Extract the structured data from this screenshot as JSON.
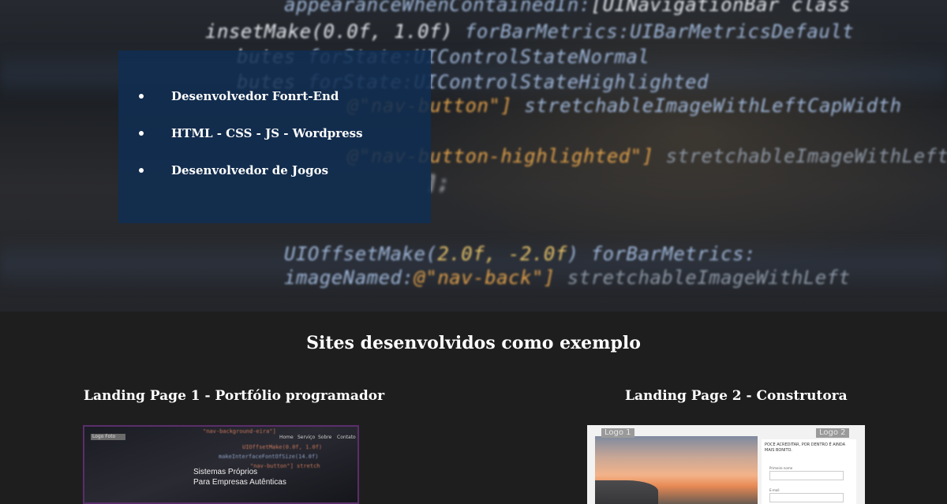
{
  "hero": {
    "code_lines": [
      {
        "parts": [
          [
            "appearanceWhenContainedIn:",
            "c-blue"
          ],
          [
            "[UINavigationBar class",
            "c-white"
          ]
        ]
      },
      {
        "parts": [
          [
            "insetMake(0.0f, 1.0f)",
            "c-white"
          ],
          [
            " forBarMetrics:",
            "c-blue"
          ],
          [
            "UIBarMetricsDefault",
            "c-blue"
          ]
        ]
      },
      {
        "parts": [
          [
            "butes",
            "c-white"
          ],
          [
            " forState:",
            "c-blue"
          ],
          [
            "UIControlStateNormal",
            "c-blue"
          ]
        ]
      },
      {
        "parts": [
          [
            "butes",
            "c-white"
          ],
          [
            " forState:",
            "c-blue"
          ],
          [
            "UIControlStateHighlighted",
            "c-blue"
          ]
        ]
      },
      {
        "parts": [
          [
            "@\"nav-button\"]",
            "c-orange"
          ],
          [
            " stretchableImageWithLeftCapWidth",
            "c-blue"
          ]
        ]
      },
      {
        "parts": [
          [
            "@\"nav-button-highlighted\"]",
            "c-orange"
          ],
          [
            " stretchableImageWithLeftCap",
            "c-gray"
          ]
        ]
      },
      {
        "parts": [
          [
            "];",
            "c-white"
          ]
        ]
      },
      {
        "parts": [
          [
            "UIOffsetMake(",
            "c-blue"
          ],
          [
            "2.0f, -2.0f",
            "c-yellow"
          ],
          [
            ") forBarMetrics:",
            "c-blue"
          ]
        ]
      },
      {
        "parts": [
          [
            "imageNamed:",
            "c-blue"
          ],
          [
            "@\"nav-back\"]",
            "c-orange"
          ],
          [
            " stretchableImageWithLeft",
            "c-gray"
          ]
        ]
      }
    ],
    "info_items": [
      "Desenvolvedor Fonrt-End",
      "HTML - CSS - JS - Wordpress",
      "Desenvolvedor de Jogos"
    ]
  },
  "examples": {
    "title": "Sites desenvolvidos como exemplo",
    "cards": [
      {
        "title": "Landing Page 1 - Portfólio programador",
        "preview": {
          "logo": "Logo Foto",
          "nav": [
            "Home",
            "Serviço",
            "Sobre",
            "Contato"
          ],
          "tagline": [
            "Sistemas Próprios",
            "Para Empresas Autênticas"
          ]
        }
      },
      {
        "title": "Landing Page 2 - Construtora",
        "preview": {
          "logo_left": "Logo 1",
          "logo_right": "Logo 2",
          "form_title": "POCE ACREDITAR, POR DENTRO É AINDA MAIS BONITO.",
          "form_labels": [
            "Primeiro nome",
            "E-mail"
          ]
        }
      }
    ]
  }
}
